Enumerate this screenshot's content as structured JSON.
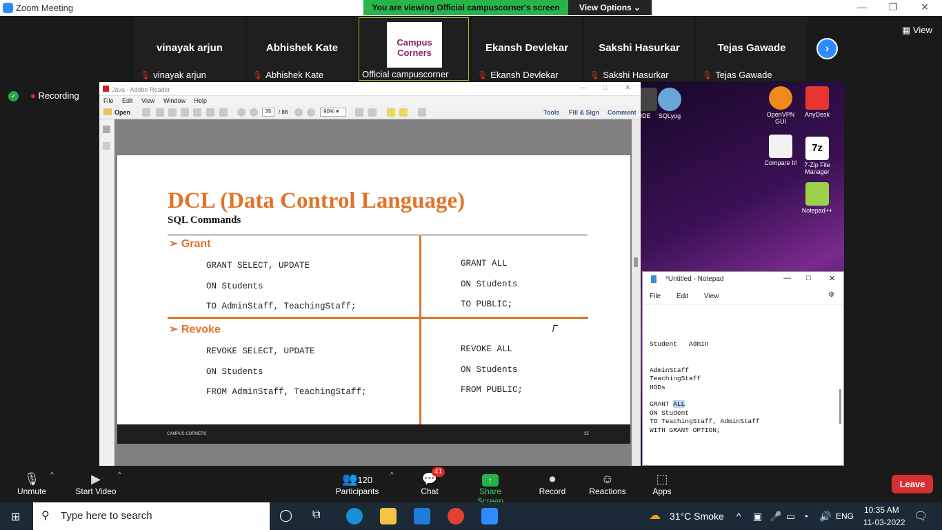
{
  "zoom": {
    "title": "Zoom Meeting",
    "banner": "You are viewing Official campuscorner's screen",
    "view_options": "View Options ⌄",
    "view": "View",
    "recording": "Recording"
  },
  "participants": [
    {
      "name": "vinayak arjun",
      "label": "vinayak arjun"
    },
    {
      "name": "Abhishek Kate",
      "label": "Abhishek Kate"
    },
    {
      "name": "",
      "label": "Official campuscorner",
      "logo": "Campus Corners"
    },
    {
      "name": "Ekansh Devlekar",
      "label": "Ekansh Devlekar"
    },
    {
      "name": "Sakshi Hasurkar",
      "label": "Sakshi Hasurkar"
    },
    {
      "name": "Tejas Gawade",
      "label": "Tejas Gawade"
    }
  ],
  "reader": {
    "title": "Java - Adobe Reader",
    "menu": [
      "File",
      "Edit",
      "View",
      "Window",
      "Help"
    ],
    "open": "Open",
    "page": "35",
    "pages": "/ 88",
    "zoom": "90%",
    "tools": "Tools",
    "fill_sign": "Fill & Sign",
    "comment": "Comment"
  },
  "slide": {
    "title": "DCL (Data Control Language)",
    "subtitle": "SQL Commands",
    "grant": "Grant",
    "revoke": "Revoke",
    "grant_left": [
      "GRANT SELECT, UPDATE",
      "ON Students",
      "TO AdminStaff, TeachingStaff;"
    ],
    "grant_right": [
      "GRANT ALL",
      "ON Students",
      "TO PUBLIC;"
    ],
    "revoke_left": [
      "REVOKE SELECT, UPDATE",
      "ON Students",
      "FROM  AdminStaff, TeachingStaff;"
    ],
    "revoke_right": [
      "REVOKE ALL",
      "ON Students",
      "FROM  PUBLIC;"
    ],
    "footer_left": "CAMPUS CORNERS",
    "footer_right": "35"
  },
  "desktop": {
    "icons": [
      "IDE",
      "SQLyog",
      "OpenVPN GUI",
      "AnyDesk",
      "Compare It!",
      "7-Zip File Manager",
      "Notepad++"
    ]
  },
  "notepad": {
    "title": "*Untitled - Notepad",
    "menu": [
      "File",
      "Edit",
      "View"
    ],
    "lines": [
      "Student   Admin",
      "AdminStaff",
      "TeachingStaff",
      "HODs",
      "GRANT ",
      "ALL",
      "ON Student",
      "TO TeachingStaff, AdminStaff",
      "WITH GRANT OPTION;"
    ]
  },
  "controls": {
    "unmute": "Unmute",
    "start_video": "Start Video",
    "participants": "Participants",
    "participant_count": "120",
    "chat": "Chat",
    "chat_badge": "41",
    "share": "Share Screen",
    "record": "Record",
    "reactions": "Reactions",
    "apps": "Apps",
    "leave": "Leave"
  },
  "taskbar": {
    "search": "Type here to search",
    "weather": "31°C  Smoke",
    "lang": "ENG",
    "time": "10:35 AM",
    "date": "11-03-2022"
  }
}
